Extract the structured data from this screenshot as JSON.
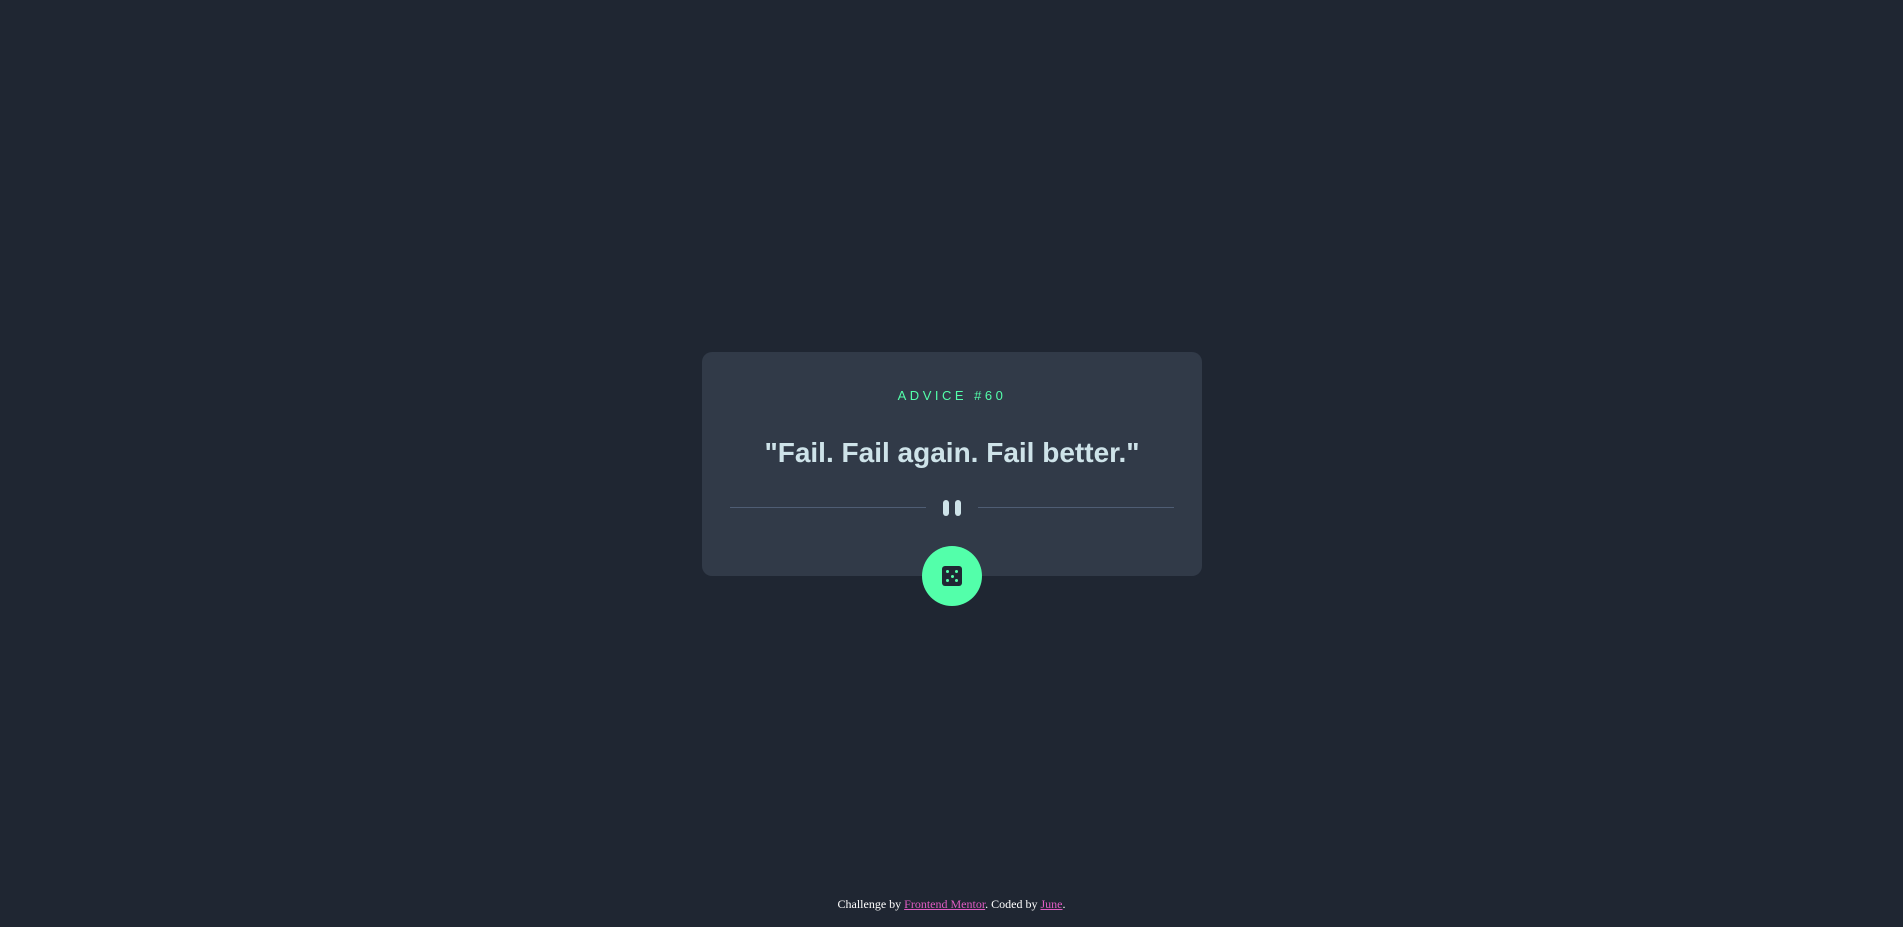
{
  "card": {
    "advice_label": "ADVICE #60",
    "quote": "\"Fail. Fail again. Fail better.\""
  },
  "divider": {
    "icon": "pause-icon"
  },
  "dice_button": {
    "icon": "dice-icon"
  },
  "footer": {
    "prefix": "Challenge by",
    "frontend_mentor_link": "Frontend Mentor",
    "middle": ". Coded by",
    "author_link": "June",
    "suffix": "."
  },
  "colors": {
    "background": "#1f2632",
    "card": "#313a48",
    "accent": "#53ffaa",
    "quote_text": "#cee3e9",
    "link": "#e05cc3"
  }
}
